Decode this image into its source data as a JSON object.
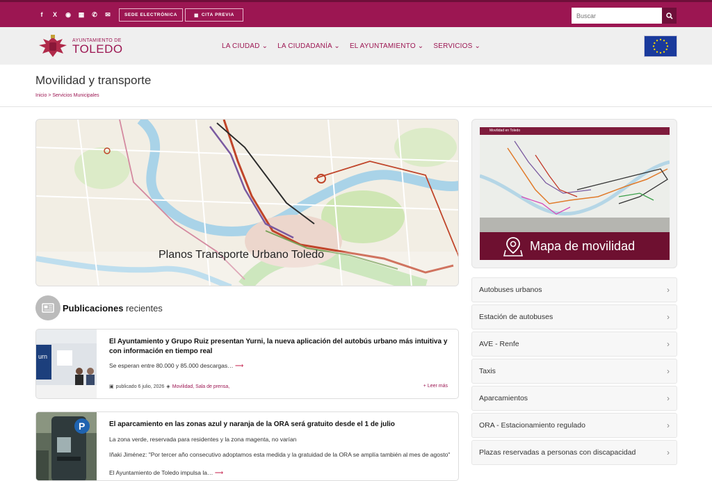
{
  "topbar": {
    "social_icons": [
      "facebook-icon",
      "x-icon",
      "rss-icon",
      "map-icon",
      "phone-icon",
      "email-icon"
    ],
    "social_glyphs": [
      "f",
      "X",
      "◉",
      "▦",
      "✆",
      "✉"
    ],
    "sede_label": "SEDE ELECTRÓNICA",
    "cita_label": "CITA PREVIA",
    "search_placeholder": "Buscar"
  },
  "nav": {
    "logo_top": "AYUNTAMIENTO DE",
    "logo_main": "TOLEDO",
    "menu": [
      {
        "label": "LA CIUDAD"
      },
      {
        "label": "LA CIUDADANÍA"
      },
      {
        "label": "EL AYUNTAMIENTO"
      },
      {
        "label": "SERVICIOS"
      }
    ]
  },
  "page": {
    "title": "Movilidad y transporte",
    "breadcrumb": [
      "Inicio",
      "Servicios Municipales"
    ]
  },
  "hero": {
    "caption": "Planos Transporte Urbano Toledo"
  },
  "publications": {
    "title_bold": "Publicaciones",
    "title_rest": "recientes",
    "items": [
      {
        "title": "El Ayuntamiento y Grupo Ruiz presentan Yurni, la nueva aplicación del autobús urbano más intuitiva y con información en tiempo real",
        "excerpt": "Se esperan entre 80.000 y 85.000 descargas…",
        "date": "publicado 6 julio, 2026",
        "categories": "Movilidad, Sala de prensa,",
        "read_more": "+ Leer más"
      },
      {
        "title": "El aparcamiento en las zonas azul y naranja de la ORA será gratuito desde el 1 de julio",
        "excerpt_1": "La zona verde, reservada para residentes y la zona magenta, no varían",
        "excerpt_2": "Iñaki Jiménez: \"Por tercer año consecutivo adoptamos esta medida y la gratuidad de la ORA se amplía también al mes de agosto\"",
        "excerpt_3": "El Ayuntamiento de Toledo impulsa la…"
      }
    ]
  },
  "sidebar": {
    "map_header": "Movilidad en Toledo",
    "banner_label": "Mapa de movilidad",
    "links": [
      {
        "label": "Autobuses urbanos"
      },
      {
        "label": "Estación de autobuses"
      },
      {
        "label": "AVE - Renfe"
      },
      {
        "label": "Taxis"
      },
      {
        "label": "Aparcamientos"
      },
      {
        "label": "ORA - Estacionamiento regulado"
      },
      {
        "label": "Plazas reservadas a personas con discapacidad"
      }
    ]
  },
  "colors": {
    "brand": "#9c1652",
    "brand_dark": "#6e0f39",
    "banner": "#6e1030",
    "arrow": "#c41c48"
  }
}
